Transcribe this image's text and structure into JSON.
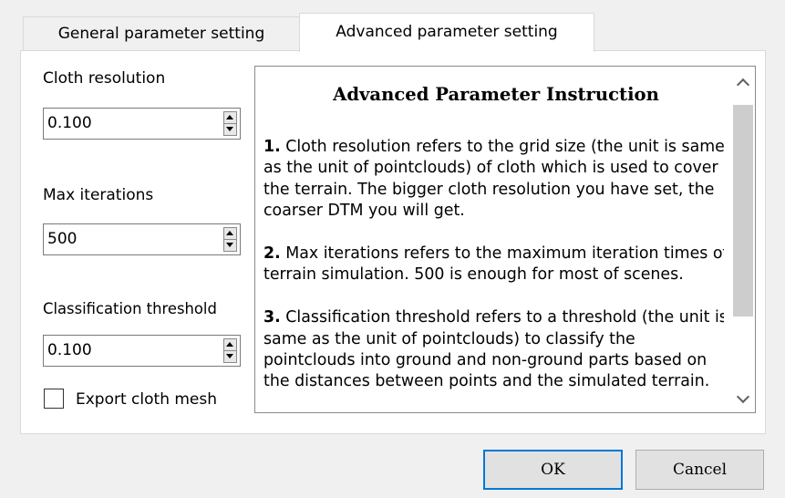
{
  "tabs": [
    {
      "label": "General parameter setting",
      "active": false
    },
    {
      "label": "Advanced parameter setting",
      "active": true
    }
  ],
  "fields": {
    "cloth_resolution": {
      "label": "Cloth resolution",
      "value": "0.100"
    },
    "max_iterations": {
      "label": "Max iterations",
      "value": "500"
    },
    "classification_threshold": {
      "label": "Classification threshold",
      "value": "0.100"
    }
  },
  "export_mesh": {
    "label": "Export cloth mesh",
    "checked": false
  },
  "instruction": {
    "title": "Advanced Parameter Instruction",
    "p1_num": "1.",
    "p1_text": " Cloth resolution refers to the grid size (the unit is same as the unit of pointclouds) of cloth which is used to cover the terrain. The bigger cloth resolution you have set, the coarser DTM  you will get.",
    "p2_num": "2.",
    "p2_text": " Max iterations refers to the maximum iteration times of terrain simulation. 500 is enough for most of scenes.",
    "p3_num": "3.",
    "p3_text": " Classification threshold refers to a threshold (the unit is same as the unit of pointclouds) to classify the pointclouds into ground and non-ground parts based on the distances between points and the simulated terrain."
  },
  "buttons": {
    "ok": "OK",
    "cancel": "Cancel"
  },
  "colors": {
    "accent": "#0078d7",
    "window_bg": "#f0f0f0",
    "panel_bg": "#ffffff",
    "scroll_thumb": "#cdcdcd"
  },
  "icons": {
    "scroll_up": "chevron-up-icon",
    "scroll_down": "chevron-down-icon",
    "spin_up": "triangle-up-icon",
    "spin_down": "triangle-down-icon"
  }
}
